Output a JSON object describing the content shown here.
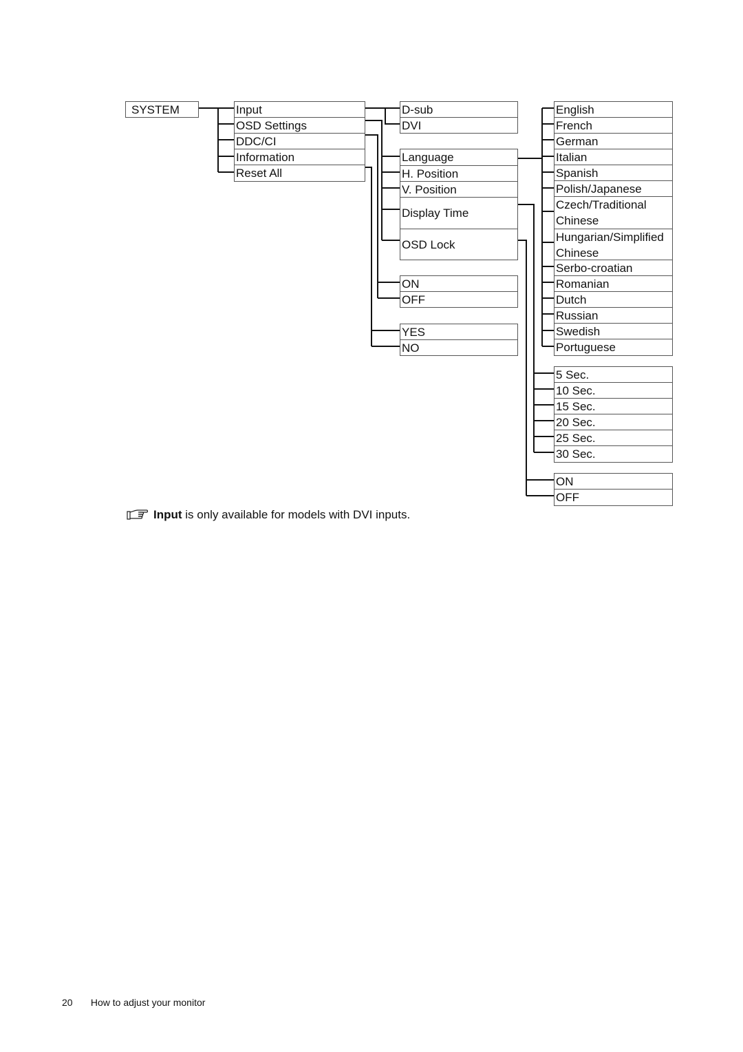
{
  "root": {
    "label": "SYSTEM"
  },
  "level1": {
    "items": [
      "Input",
      "OSD Settings",
      "DDC/CI",
      "Information",
      "Reset All"
    ]
  },
  "input_options": {
    "items": [
      "D-sub",
      "DVI"
    ]
  },
  "osd_settings": {
    "items": [
      "Language",
      "H. Position",
      "V. Position",
      "Display Time",
      "OSD Lock"
    ]
  },
  "ddcci_options": {
    "items": [
      "ON",
      "OFF"
    ]
  },
  "reset_options": {
    "items": [
      "YES",
      "NO"
    ]
  },
  "languages": {
    "items": [
      "English",
      "French",
      "German",
      "Italian",
      "Spanish",
      "Polish/Japanese",
      "Czech/Traditional Chinese",
      "Hungarian/Simplified Chinese",
      "Serbo-croatian",
      "Romanian",
      "Dutch",
      "Russian",
      "Swedish",
      "Portuguese"
    ],
    "two_line": {
      "6": [
        "Czech/Traditional",
        "Chinese"
      ],
      "7": [
        "Hungarian/Simplified",
        "Chinese"
      ]
    }
  },
  "display_time": {
    "items": [
      "5 Sec.",
      "10 Sec.",
      "15 Sec.",
      "20 Sec.",
      "25 Sec.",
      "30 Sec."
    ]
  },
  "osd_lock_options": {
    "items": [
      "ON",
      "OFF"
    ]
  },
  "note": {
    "icon": "pointing-hand-icon",
    "bold": "Input",
    "text": " is only available for models with DVI inputs."
  },
  "footer": {
    "page_number": "20",
    "section": "How to adjust your monitor"
  }
}
